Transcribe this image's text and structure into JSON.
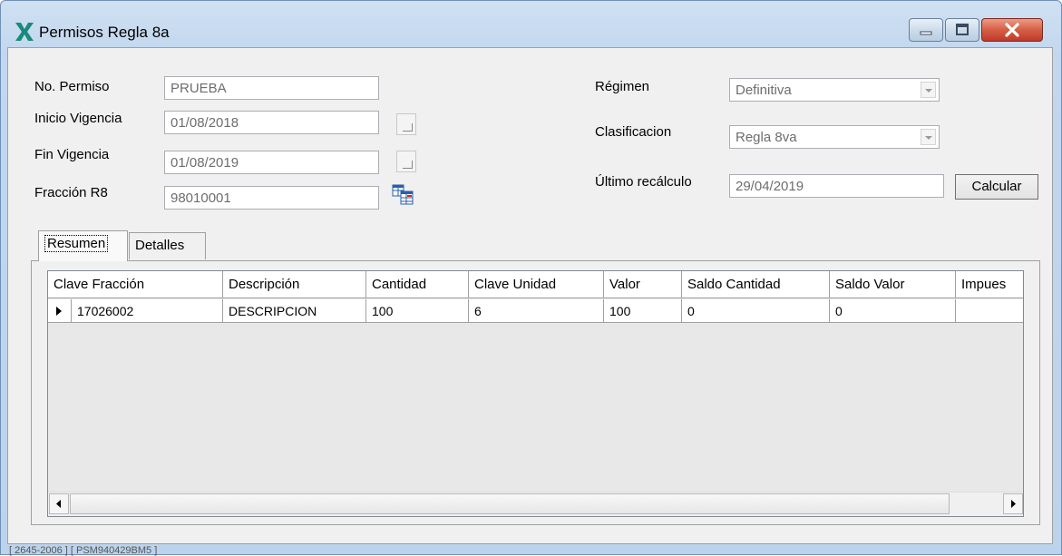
{
  "window": {
    "title": "Permisos Regla 8a",
    "icon": "x-logo-icon",
    "accent_color": "#1a8a7a"
  },
  "form": {
    "no_permiso_label": "No. Permiso",
    "no_permiso_value": "PRUEBA",
    "inicio_label": "Inicio Vigencia",
    "inicio_value": "01/08/2018",
    "fin_label": "Fin Vigencia",
    "fin_value": "01/08/2019",
    "fraccion_label": "Fracción R8",
    "fraccion_value": "98010001",
    "regimen_label": "Régimen",
    "regimen_value": "Definitiva",
    "clasificacion_label": "Clasificacion",
    "clasificacion_value": "Regla 8va",
    "recalculo_label": "Último recálculo",
    "recalculo_value": "29/04/2019",
    "calcular_label": "Calcular"
  },
  "tabs": [
    {
      "label": "Resumen",
      "active": true
    },
    {
      "label": "Detalles",
      "active": false
    }
  ],
  "grid": {
    "columns": [
      "Clave Fracción",
      "Descripción",
      "Cantidad",
      "Clave Unidad",
      "Valor",
      "Saldo Cantidad",
      "Saldo Valor",
      "Impues"
    ],
    "rows": [
      [
        "17026002",
        "DESCRIPCION",
        "100",
        "6",
        "100",
        "0",
        "0",
        ""
      ]
    ]
  },
  "status": {
    "text": "[ 2645-2006 ]  [ PSM940429BM5 ]"
  }
}
